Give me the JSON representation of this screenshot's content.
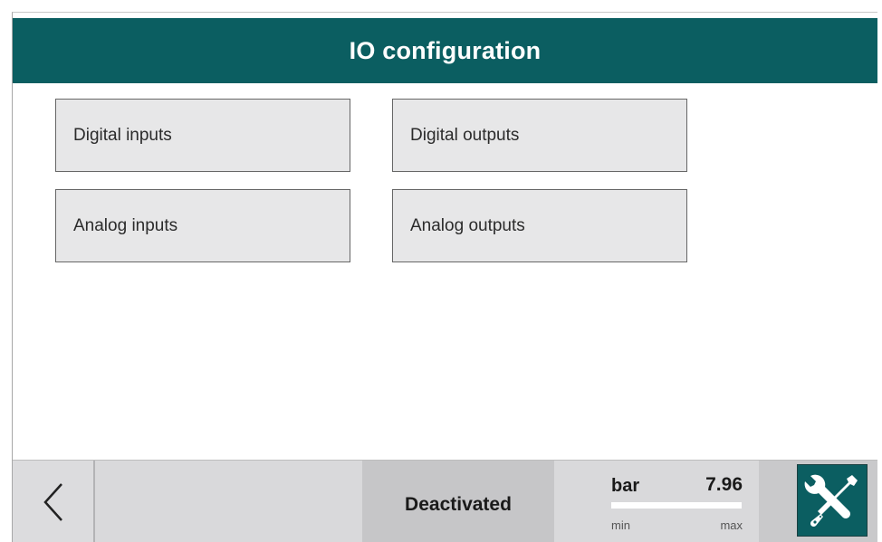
{
  "header": {
    "title": "IO configuration"
  },
  "tiles": [
    {
      "label": "Digital inputs"
    },
    {
      "label": "Digital outputs"
    },
    {
      "label": "Analog inputs"
    },
    {
      "label": "Analog outputs"
    }
  ],
  "footer": {
    "back_icon": "chevron-left-icon",
    "status": "Deactivated",
    "gauge": {
      "unit": "bar",
      "value": "7.96",
      "min_label": "min",
      "max_label": "max",
      "fill_fraction": 1.0
    },
    "tools_icon": "wrench-screwdriver-icon"
  },
  "colors": {
    "brand": "#0b5e61",
    "tile_bg": "#e7e7e8",
    "footer_bg": "#d9d9db"
  }
}
